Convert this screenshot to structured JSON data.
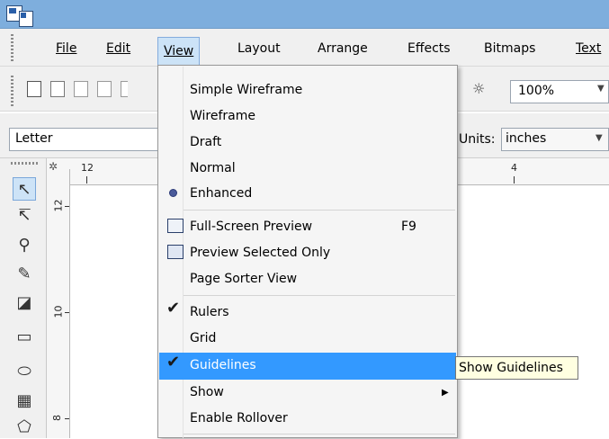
{
  "menubar": {
    "items": [
      {
        "label": "File",
        "active": false
      },
      {
        "label": "Edit",
        "active": false
      },
      {
        "label": "View",
        "active": true
      },
      {
        "label": "Layout",
        "active": false
      },
      {
        "label": "Arrange",
        "active": false
      },
      {
        "label": "Effects",
        "active": false
      },
      {
        "label": "Bitmaps",
        "active": false
      },
      {
        "label": "Text",
        "active": false
      }
    ]
  },
  "toolbar": {
    "zoom_value": "100%",
    "icons": [
      "new-icon",
      "open-icon",
      "save-icon",
      "print-icon",
      "zoom-tool-icon"
    ]
  },
  "property_bar": {
    "paper_size": "Letter",
    "units_label": "Units:",
    "units_value": "inches"
  },
  "rulers": {
    "h_labels": [
      "12",
      "4"
    ],
    "v_labels": [
      "12",
      "10",
      "8"
    ]
  },
  "toolbox": {
    "tools": [
      "pick-tool-icon",
      "shape-tool-icon",
      "zoom-tool-icon",
      "freehand-tool-icon",
      "smart-fill-icon",
      "rectangle-tool-icon",
      "ellipse-tool-icon",
      "table-tool-icon",
      "polygon-tool-icon"
    ]
  },
  "view_menu": {
    "items": [
      {
        "label": "Simple Wireframe",
        "mark": "none"
      },
      {
        "label": "Wireframe",
        "mark": "none"
      },
      {
        "label": "Draft",
        "mark": "none"
      },
      {
        "label": "Normal",
        "mark": "none"
      },
      {
        "label": "Enhanced",
        "mark": "radio"
      },
      {
        "label": "Full-Screen Preview",
        "shortcut": "F9",
        "mark": "icon"
      },
      {
        "label": "Preview Selected Only",
        "mark": "icon"
      },
      {
        "label": "Page Sorter View",
        "mark": "none"
      },
      {
        "label": "Rulers",
        "mark": "check"
      },
      {
        "label": "Grid",
        "mark": "none"
      },
      {
        "label": "Guidelines",
        "mark": "check",
        "highlighted": true
      },
      {
        "label": "Show",
        "mark": "none",
        "submenu": true
      },
      {
        "label": "Enable Rollover",
        "mark": "none"
      }
    ],
    "highlight_color": "#3399ff"
  },
  "tooltip": {
    "text": "Show Guidelines"
  },
  "colors": {
    "titlebar": "#7eaedd",
    "menu_active": "#cce3f7",
    "tooltip_bg": "#ffffe1"
  }
}
